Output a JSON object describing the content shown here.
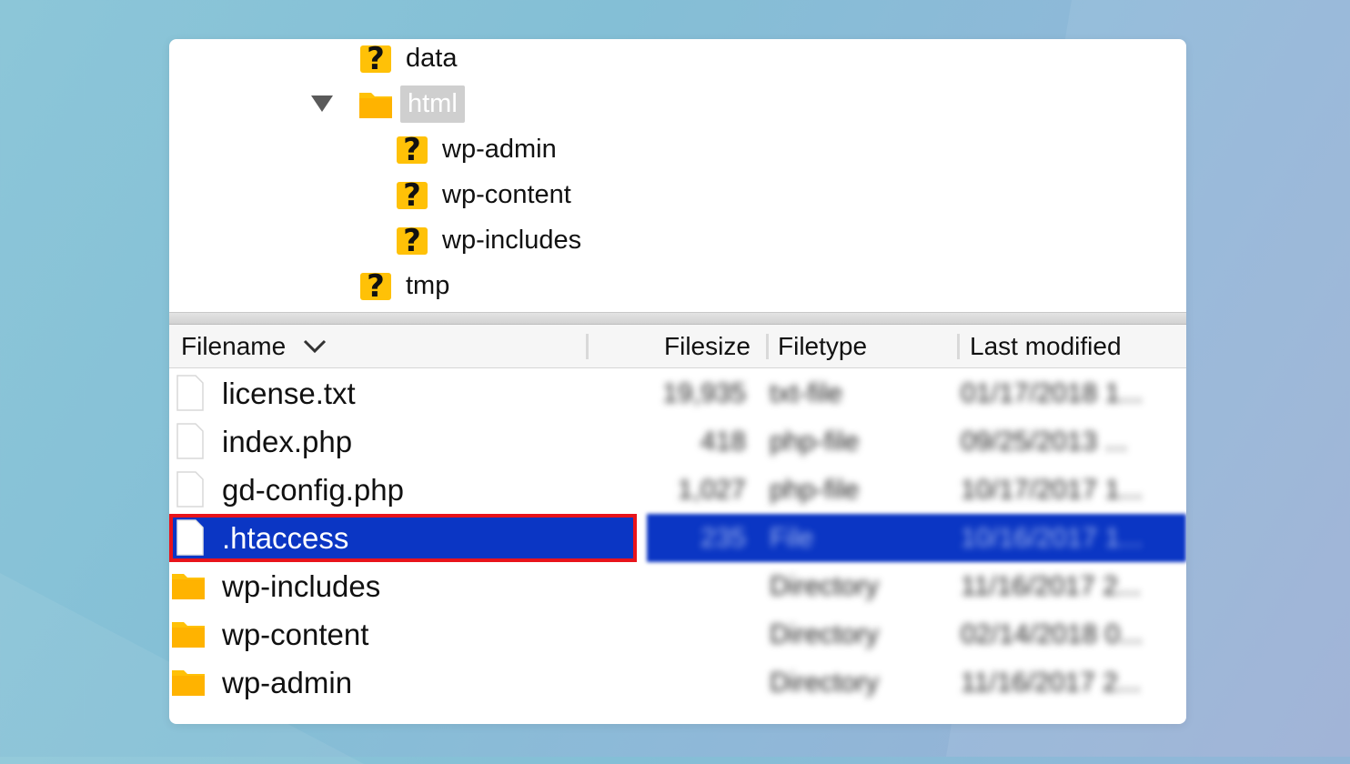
{
  "tree": {
    "items": [
      {
        "label": "data",
        "icon": "unknown-folder-icon"
      },
      {
        "label": "html",
        "icon": "folder-icon",
        "expanded": true,
        "selected": true
      },
      {
        "label": "wp-admin",
        "icon": "unknown-folder-icon"
      },
      {
        "label": "wp-content",
        "icon": "unknown-folder-icon"
      },
      {
        "label": "wp-includes",
        "icon": "unknown-folder-icon"
      },
      {
        "label": "tmp",
        "icon": "unknown-folder-icon"
      }
    ]
  },
  "list": {
    "columns": {
      "filename": "Filename",
      "filesize": "Filesize",
      "filetype": "Filetype",
      "last_modified": "Last modified"
    },
    "rows": [
      {
        "name": "license.txt",
        "size": "19,935",
        "type": "txt-file",
        "modified": "01/17/2018 1...",
        "icon": "file-icon"
      },
      {
        "name": "index.php",
        "size": "418",
        "type": "php-file",
        "modified": "09/25/2013 ...",
        "icon": "file-icon"
      },
      {
        "name": "gd-config.php",
        "size": "1,027",
        "type": "php-file",
        "modified": "10/17/2017 1...",
        "icon": "file-icon"
      },
      {
        "name": ".htaccess",
        "size": "235",
        "type": "File",
        "modified": "10/16/2017 1...",
        "icon": "file-icon",
        "selected": true
      },
      {
        "name": "wp-includes",
        "size": "",
        "type": "Directory",
        "modified": "11/16/2017 2...",
        "icon": "folder-icon"
      },
      {
        "name": "wp-content",
        "size": "",
        "type": "Directory",
        "modified": "02/14/2018 0...",
        "icon": "folder-icon"
      },
      {
        "name": "wp-admin",
        "size": "",
        "type": "Directory",
        "modified": "11/16/2017 2...",
        "icon": "folder-icon"
      }
    ]
  },
  "colors": {
    "selection": "#0b36c4",
    "highlight_border": "#e8141b",
    "folder": "#ffc107"
  }
}
